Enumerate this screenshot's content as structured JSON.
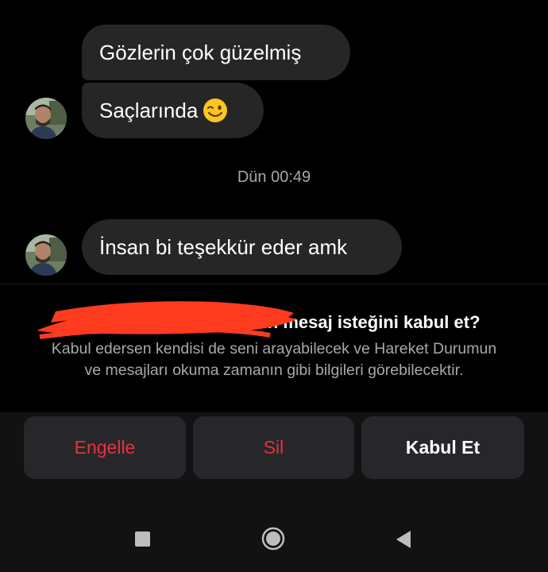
{
  "chat": {
    "messages": [
      {
        "text": "Gözlerin çok güzelmiş",
        "sender": "other"
      },
      {
        "text": "Saçlarında",
        "emoji": "winking-face-emoji",
        "sender": "other"
      },
      {
        "text": "İnsan bi teşekkür eder amk",
        "sender": "other"
      }
    ],
    "timestamp": "Dün 00:49"
  },
  "request": {
    "title_suffix": "'in mesaj isteğini kabul et?",
    "description": "Kabul edersen kendisi de seni arayabilecek ve Hareket Durumun ve mesajları okuma zamanın gibi bilgileri görebilecektir."
  },
  "actions": {
    "block_label": "Engelle",
    "delete_label": "Sil",
    "accept_label": "Kabul Et"
  },
  "colors": {
    "background": "#000000",
    "bubble": "#262626",
    "danger": "#e5323f",
    "redaction": "#ff3b1f",
    "button_bg": "#27272b"
  },
  "nav": {
    "icons": [
      "recents-icon",
      "home-icon",
      "back-icon"
    ]
  }
}
